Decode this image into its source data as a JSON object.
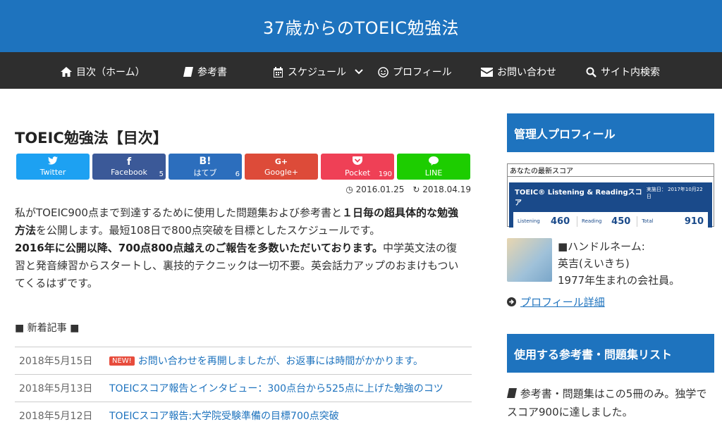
{
  "site": {
    "title": "37歳からのTOEIC勉強法"
  },
  "nav": [
    {
      "icon": "home-icon",
      "label": "目次（ホーム）"
    },
    {
      "icon": "book-icon",
      "label": "参考書"
    },
    {
      "icon": "calendar-icon",
      "label": "スケジュール"
    },
    {
      "icon": "smile-icon",
      "label": "プロフィール"
    },
    {
      "icon": "mail-icon",
      "label": "お問い合わせ"
    },
    {
      "icon": "search-icon",
      "label": "サイト内検索"
    }
  ],
  "article": {
    "title": "TOEIC勉強法【目次】",
    "share": [
      {
        "glyph": "🐦",
        "label": "Twitter",
        "count": "",
        "color": "#1da1f2"
      },
      {
        "glyph": "f",
        "label": "Facebook",
        "count": "5",
        "color": "#3b5998"
      },
      {
        "glyph": "B!",
        "label": "はてブ",
        "count": "6",
        "color": "#2c6ebd"
      },
      {
        "glyph": "G+",
        "label": "Google+",
        "count": "",
        "color": "#dd4b39"
      },
      {
        "glyph": "⌄",
        "label": "Pocket",
        "count": "190",
        "color": "#ef4056"
      },
      {
        "glyph": "💬",
        "label": "LINE",
        "count": "",
        "color": "#1dcd00"
      }
    ],
    "published": "2016.01.25",
    "updated": "2018.04.19",
    "intro": {
      "p1a": "私がTOEIC900点まで到達するために使用した問題集および参考書と",
      "p1b": "１日毎の超具体的な勉強方法",
      "p1c": "を公開します。最短108日で800点突破を目標としたスケジュールです。",
      "p2a": "2016年に公開以降、700点800点越えのご報告を多数いただいております。",
      "p2b": "中学英文法の復習と発音練習からスタートし、裏技的テクニックは一切不要。英会話力アップのおまけもついてくるはずです。"
    }
  },
  "news": {
    "heading": "■ 新着記事 ■",
    "badge": "NEW!",
    "items": [
      {
        "date": "2018年5月15日",
        "title": "お問い合わせを再開しましたが、お返事には時間がかかります。"
      },
      {
        "date": "2018年5月13日",
        "title": "TOEICスコア報告とインタビュー：300点台から525点に上げた勉強のコツ"
      },
      {
        "date": "2018年5月12日",
        "title": "TOEICスコア報告:大学院受験準備の目標700点突破"
      }
    ]
  },
  "sidebar": {
    "profile_heading": "管理人プロフィール",
    "score": {
      "caption": "あなたの最新スコア",
      "title": "TOEIC® Listening & Readingスコア",
      "date": "実施日： 2017年10月22日",
      "listening_label": "Listening",
      "listening": "460",
      "reading_label": "Reading",
      "reading": "450",
      "total_label": "Total",
      "total": "910"
    },
    "profile": {
      "line1": "■ハンドルネーム:",
      "line2": "英吉(えいきち)",
      "line3": "1977年生まれの会社員。",
      "link": "プロフィール詳細"
    },
    "books_heading": "使用する参考書・問題集リスト",
    "books_text1": "参考書・問題集はこの5冊のみ。独学で",
    "books_text2": "スコア900に達しました。"
  }
}
